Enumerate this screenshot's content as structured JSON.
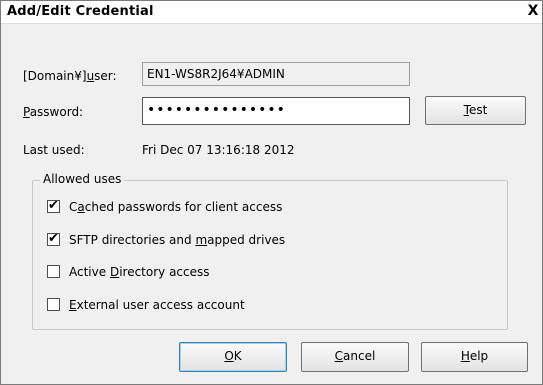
{
  "window": {
    "title": "Add/Edit Credential",
    "close_glyph": "X"
  },
  "form": {
    "user_label_pre": "[Domain¥]",
    "user_label_key": "u",
    "user_label_post": "ser:",
    "user_value": "EN1-WS8R2J64¥ADMIN",
    "password_label_key": "P",
    "password_label_post": "assword:",
    "password_value": "•••••••••••••••",
    "last_used_label": "Last used:",
    "last_used_value": "Fri Dec 07 13:16:18 2012"
  },
  "buttons": {
    "test_key": "T",
    "test_rest": "est",
    "ok_key": "O",
    "ok_rest": "K",
    "cancel_key": "C",
    "cancel_rest": "ancel",
    "help_key": "H",
    "help_rest": "elp"
  },
  "allowed_uses": {
    "legend": "Allowed uses",
    "items": [
      {
        "pre": "C",
        "key": "a",
        "post": "ched passwords for client access",
        "checked": true
      },
      {
        "pre": "SFTP directories and ",
        "key": "m",
        "post": "apped drives",
        "checked": true
      },
      {
        "pre": "Active ",
        "key": "D",
        "post": "irectory access",
        "checked": false
      },
      {
        "pre": "",
        "key": "E",
        "post": "xternal user access account",
        "checked": false
      }
    ]
  },
  "colors": {
    "dialog_bg": "#f0f0f0",
    "default_button_border": "#3c7fb1"
  }
}
